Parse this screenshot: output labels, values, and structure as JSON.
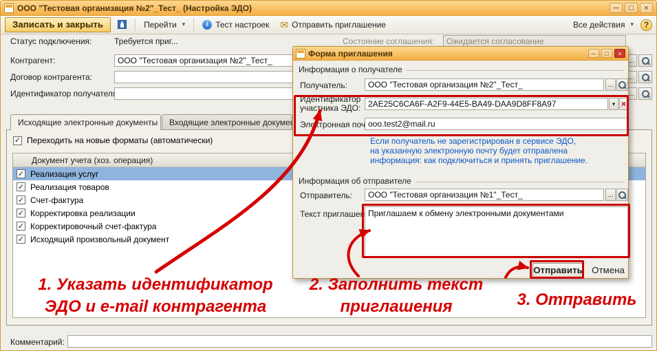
{
  "window": {
    "title": "ООО \"Тестовая организация №2\"_Тест_ (Настройка ЭДО)"
  },
  "toolbar": {
    "save_close": "Записать и закрыть",
    "goto": "Перейти",
    "test_settings": "Тест настроек",
    "send_invitation": "Отправить приглашение",
    "all_actions": "Все действия",
    "help": "?"
  },
  "form": {
    "status_label": "Статус подключения:",
    "status_value": "Требуется приг...",
    "agreement_label": "Состояние соглашения:",
    "agreement_value": "Ожидается согласование",
    "counterparty_label": "Контрагент:",
    "counterparty_value": "ООО \"Тестовая организация №2\"_Тест_",
    "contract_label": "Договор контрагента:",
    "receiver_id_label": "Идентификатор получателя:",
    "comment_label": "Комментарий:"
  },
  "tabs": {
    "outgoing": "Исходящие электронные документы",
    "incoming": "Входящие электронные документы"
  },
  "outgoing": {
    "auto_format": "Переходить на новые форматы (автоматически)",
    "table_header": "Документ учета (хоз. операция)",
    "rows": [
      {
        "label": "Реализация услуг"
      },
      {
        "label": "Реализация товаров"
      },
      {
        "label": "Счет-фактура"
      },
      {
        "label": "Корректировка реализации"
      },
      {
        "label": "Корректировочный счет-фактура"
      },
      {
        "label": "Исходящий произвольный документ"
      }
    ]
  },
  "dialog": {
    "title": "Форма приглашения",
    "recipient_group": "Информация о получателе",
    "recipient_label": "Получатель:",
    "recipient_value": "ООО \"Тестовая организация №2\"_Тест_",
    "edo_id_label": "Идентификатор участника ЭДО:",
    "edo_id_value": "2AE25C6CA6F-A2F9-44E5-BA49-DAA9D8FF8A97",
    "email_label": "Электронная почта:",
    "email_value": "ooo.test2@mail.ru",
    "hint_lines": [
      "Если получатель не зарегистрирован в сервисе ЭДО,",
      "на указанную электронную почту будет отправлена",
      "информация: как подключиться и принять приглашение."
    ],
    "sender_group": "Информация об отправителе",
    "sender_label": "Отправитель:",
    "sender_value": "ООО \"Тестовая организация №1\"_Тест_",
    "invite_text_label": "Текст приглашения:",
    "invite_text_value": "Приглашаем к обмену электронными документами",
    "send_button": "Отправить",
    "cancel_button": "Отмена"
  },
  "annotations": {
    "step1_line1": "1. Указать идентификатор",
    "step1_line2": "ЭДО и e-mail контрагента",
    "step2_line1": "2. Заполнить текст",
    "step2_line2": "приглашения",
    "step3": "3. Отправить"
  }
}
